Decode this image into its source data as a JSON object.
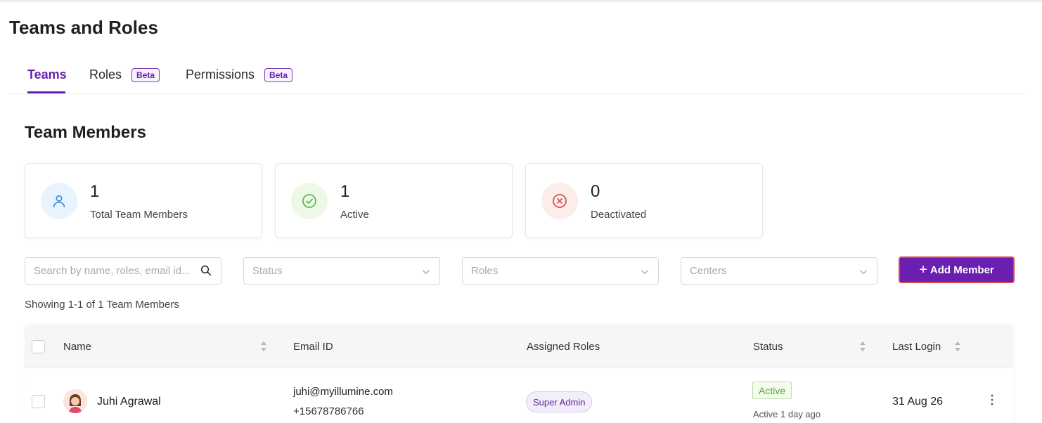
{
  "page": {
    "title": "Teams and Roles"
  },
  "tabs": [
    {
      "label": "Teams",
      "active": true,
      "badge": ""
    },
    {
      "label": "Roles",
      "active": false,
      "badge": "Beta"
    },
    {
      "label": "Permissions",
      "active": false,
      "badge": "Beta"
    }
  ],
  "section": {
    "title": "Team Members"
  },
  "stats": [
    {
      "value": "1",
      "label": "Total Team Members",
      "icon": "user-icon",
      "color": "#3a8be0",
      "bg": "#e8f3fd"
    },
    {
      "value": "1",
      "label": "Active",
      "icon": "check-circle-icon",
      "color": "#5cb85c",
      "bg": "#eef8e6"
    },
    {
      "value": "0",
      "label": "Deactivated",
      "icon": "x-circle-icon",
      "color": "#d9534f",
      "bg": "#fcecec"
    }
  ],
  "filters": {
    "search_placeholder": "Search by name, roles, email id...",
    "status": "Status",
    "roles": "Roles",
    "centers": "Centers"
  },
  "actions": {
    "add_member": "Add Member"
  },
  "summary": {
    "showing": "Showing 1-1 of 1 Team Members"
  },
  "table": {
    "headers": {
      "name": "Name",
      "email": "Email ID",
      "roles": "Assigned Roles",
      "status": "Status",
      "last_login": "Last Login"
    },
    "rows": [
      {
        "name": "Juhi Agrawal",
        "email": "juhi@myillumine.com",
        "phone": "+15678786766",
        "role": "Super Admin",
        "status": "Active",
        "status_sub": "Active 1 day ago",
        "last_login": "31 Aug 26"
      }
    ]
  },
  "colors": {
    "accent": "#6a1fb0",
    "add_button_border": "#d84a4a",
    "active_green": "#52a830"
  }
}
